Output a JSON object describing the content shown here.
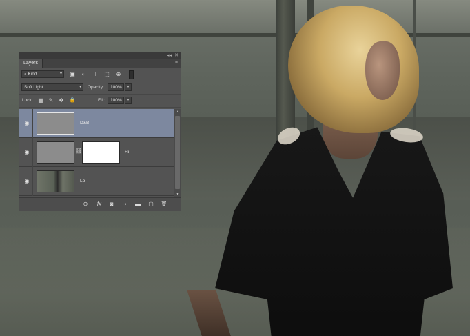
{
  "panel": {
    "tab_label": "Layers",
    "collapse_glyph": "◂◂",
    "close_glyph": "✕",
    "menu_glyph": "≡"
  },
  "filter": {
    "kind_label": "Kind",
    "search_glyph": "⌕",
    "icons": [
      "image-filter-icon",
      "adjustment-filter-icon",
      "type-filter-icon",
      "shape-filter-icon",
      "smart-object-filter-icon"
    ],
    "icon_glyphs": [
      "▣",
      "◐",
      "T",
      "⬚",
      "⊕"
    ]
  },
  "blend": {
    "mode": "Soft Light",
    "opacity_label": "Opacity:",
    "opacity_value": "100%"
  },
  "lock": {
    "label": "Lock:",
    "icons": [
      "lock-transparent-icon",
      "lock-image-icon",
      "lock-position-icon",
      "lock-all-icon"
    ],
    "glyphs": [
      "▦",
      "✎",
      "✥",
      "🔒"
    ],
    "fill_label": "Fill:",
    "fill_value": "100%"
  },
  "layers": [
    {
      "name": "D&B",
      "selected": true,
      "has_mask": false
    },
    {
      "name": "Hi",
      "selected": false,
      "has_mask": true
    },
    {
      "name": "Lo",
      "selected": false,
      "has_mask": false
    }
  ],
  "footer": {
    "buttons": [
      {
        "name": "link-layers-icon",
        "glyph": "⊝"
      },
      {
        "name": "layer-style-icon",
        "glyph": "fx"
      },
      {
        "name": "add-mask-icon",
        "glyph": "◙"
      },
      {
        "name": "adjustment-layer-icon",
        "glyph": "◑"
      },
      {
        "name": "new-group-icon",
        "glyph": "▬"
      },
      {
        "name": "new-layer-icon",
        "glyph": "▢"
      },
      {
        "name": "delete-layer-icon",
        "glyph": "🗑"
      }
    ]
  }
}
